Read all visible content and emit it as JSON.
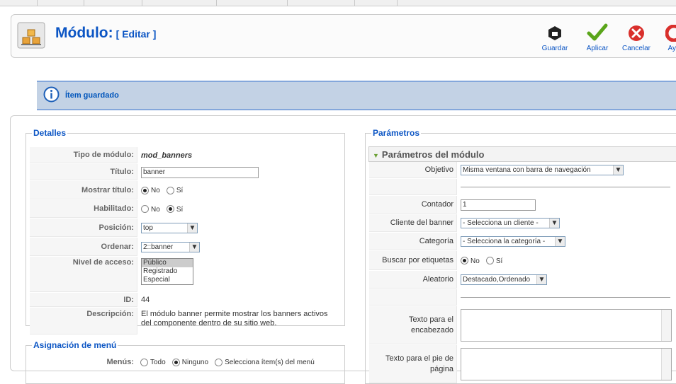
{
  "header": {
    "title": "Módulo:",
    "subtitle": "[ Editar ]",
    "toolbar": {
      "save_label": "Guardar",
      "apply_label": "Aplicar",
      "cancel_label": "Cancelar",
      "help_label": "Ayu"
    }
  },
  "message": {
    "text": "Ítem guardado"
  },
  "details": {
    "legend": "Detalles",
    "type_label": "Tipo de módulo:",
    "type_value": "mod_banners",
    "title_label": "Título:",
    "title_value": "banner",
    "show_title_label": "Mostrar título:",
    "enabled_label": "Habilitado:",
    "position_label": "Posición:",
    "position_value": "top",
    "order_label": "Ordenar:",
    "order_value": "2::banner",
    "access_label": "Nivel de acceso:",
    "access_options": [
      "Público",
      "Registrado",
      "Especial"
    ],
    "id_label": "ID:",
    "id_value": "44",
    "description_label": "Descripción:",
    "description_value": "El módulo banner permite mostrar los banners activos del componente dentro de su sitio web.",
    "no_label": "No",
    "yes_label": "Sí"
  },
  "menu_assignment": {
    "legend": "Asignación de menú",
    "menus_label": "Menús:",
    "all_label": "Todo",
    "none_label": "Ninguno",
    "select_label": "Selecciona ítem(s) del menú"
  },
  "params": {
    "legend": "Parámetros",
    "section_title": "Parámetros del módulo",
    "target_label": "Objetivo",
    "target_value": "Misma ventana con barra de navegación",
    "count_label": "Contador",
    "count_value": "1",
    "client_label": "Cliente del banner",
    "client_value": "- Selecciona un cliente -",
    "category_label": "Categoría",
    "category_value": "- Selecciona la categoría -",
    "search_tags_label": "Buscar por etiquetas",
    "random_label": "Aleatorio",
    "random_value": "Destacado,Ordenado",
    "header_text_label": "Texto para el encabezado",
    "footer_text_label": "Texto para el pie de página",
    "no_label": "No",
    "yes_label": "Sí"
  }
}
